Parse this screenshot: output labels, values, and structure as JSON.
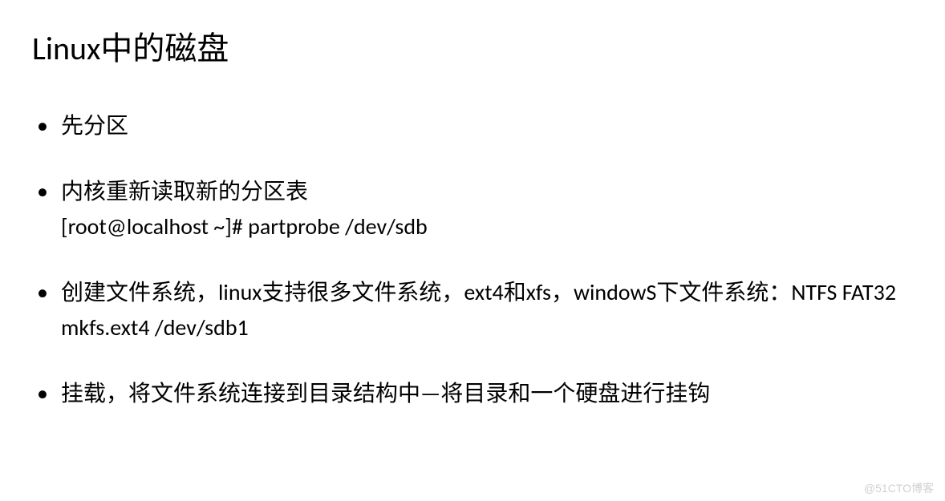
{
  "title": "Linux中的磁盘",
  "bullets": [
    {
      "text": "先分区"
    },
    {
      "text": "内核重新读取新的分区表",
      "sub": [
        "[root@localhost ~]# partprobe /dev/sdb"
      ]
    },
    {
      "text": "创建文件系统，linux支持很多文件系统，ext4和xfs，windowS下文件系统：NTFS   FAT32",
      "sub": [
        "mkfs.ext4 /dev/sdb1"
      ]
    },
    {
      "text": "挂载，将文件系统连接到目录结构中—将目录和一个硬盘进行挂钩"
    }
  ],
  "watermark": "@51CTO博客"
}
